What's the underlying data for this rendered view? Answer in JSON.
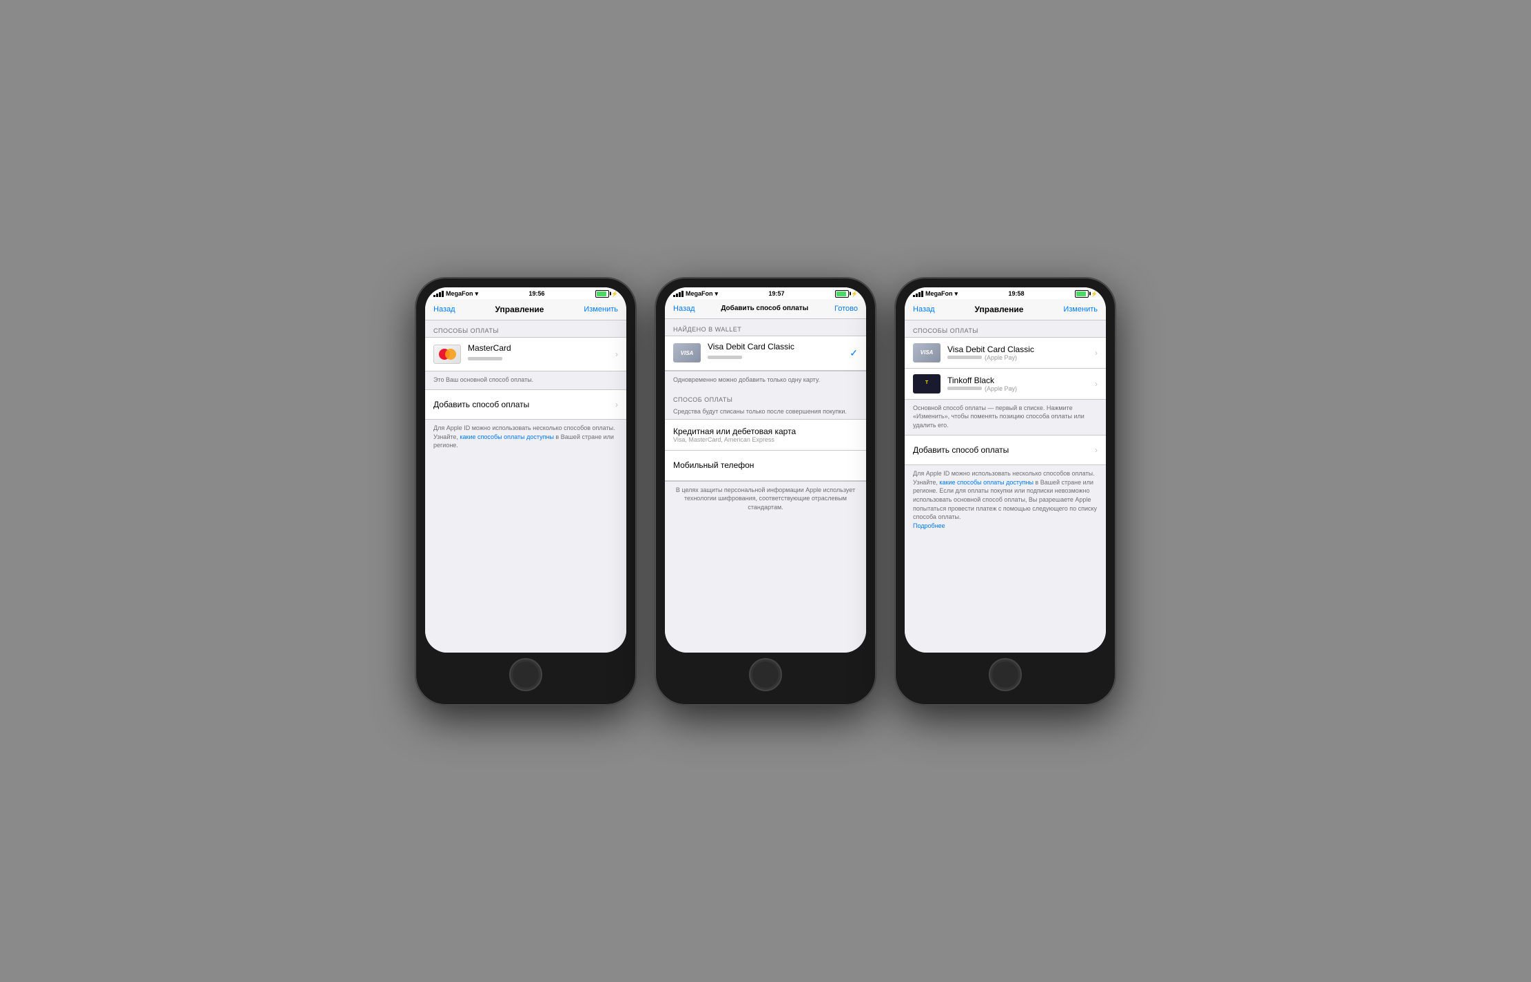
{
  "colors": {
    "blue": "#007aff",
    "separator": "#c8c7cc",
    "bg": "#efeff4",
    "text_primary": "#000000",
    "text_secondary": "#6d6d72",
    "text_muted": "#999999",
    "white": "#ffffff",
    "green": "#4cd964"
  },
  "phone1": {
    "status": {
      "carrier": "MegaFon",
      "time": "19:56",
      "wifi": true
    },
    "nav": {
      "back": "Назад",
      "title": "Управление",
      "action": "Изменить"
    },
    "section_payment": "СПОСОБЫ ОПЛАТЫ",
    "mastercard_label": "MasterCard",
    "primary_hint": "Это Ваш основной способ оплаты.",
    "add_payment": "Добавить способ оплаты",
    "footer_text": "Для Apple ID можно использовать несколько способов оплаты. Узнайте, ",
    "footer_link": "какие способы оплаты доступны",
    "footer_text2": " в Вашей стране или регионе."
  },
  "phone2": {
    "status": {
      "carrier": "MegaFon",
      "time": "19:57",
      "wifi": true
    },
    "nav": {
      "back": "Назад",
      "title": "Добавить способ оплаты",
      "action": "Готово"
    },
    "section_found": "НАЙДЕНО В WALLET",
    "visa_label": "Visa Debit Card Classic",
    "one_at_time": "Одновременно можно добавить только одну карту.",
    "section_payment": "СПОСОБ ОПЛАТЫ",
    "payment_note": "Средства будут списаны только после совершения покупки.",
    "credit_card_title": "Кредитная или дебетовая карта",
    "credit_card_sub": "Visa, MasterCard, American Express",
    "mobile_phone": "Мобильный телефон",
    "security_note": "В целях защиты персональной информации Apple использует технологии шифрования, соответствующие отраслевым стандартам."
  },
  "phone3": {
    "status": {
      "carrier": "MegaFon",
      "time": "19:58",
      "wifi": true
    },
    "nav": {
      "back": "Назад",
      "title": "Управление",
      "action": "Изменить"
    },
    "section_payment": "СПОСОБЫ ОПЛАТЫ",
    "visa_label": "Visa Debit Card Classic",
    "visa_sub": "(Apple Pay)",
    "tinkoff_label": "Tinkoff Black",
    "tinkoff_sub": "(Apple Pay)",
    "primary_hint": "Основной способ оплаты — первый в списке. Нажмите «Изменить», чтобы поменять позицию способа оплаты или удалить его.",
    "add_payment": "Добавить способ оплаты",
    "footer_text": "Для Apple ID можно использовать несколько способов оплаты. Узнайте, ",
    "footer_link": "какие способы оплаты доступны",
    "footer_text2": " в Вашей стране или регионе. Если для оплаты покупки или подписки невозможно использовать основной способ оплаты, Вы разрешаете Apple попытаться провести платеж с помощью следующего по списку способа оплаты.",
    "more_link": "Подробнее"
  }
}
